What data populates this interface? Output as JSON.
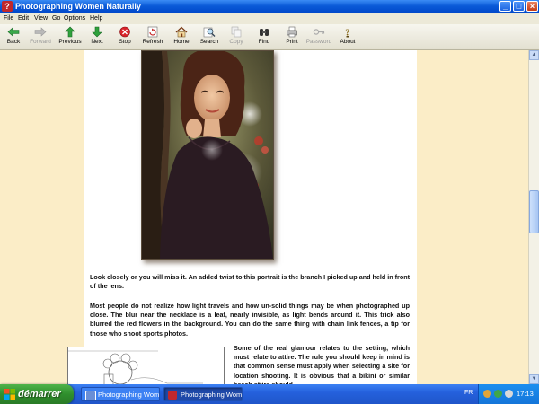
{
  "window": {
    "title": "Photographing Women Naturally",
    "app_icon": "help-book-icon"
  },
  "menu": [
    "File",
    "Edit",
    "View",
    "Go",
    "Options",
    "Help"
  ],
  "toolbar": [
    {
      "label": "Back",
      "icon": "back-arrow-icon",
      "enabled": true
    },
    {
      "label": "Forward",
      "icon": "forward-arrow-icon",
      "enabled": false
    },
    {
      "label": "Previous",
      "icon": "previous-arrow-icon",
      "enabled": true
    },
    {
      "label": "Next",
      "icon": "next-arrow-icon",
      "enabled": true
    },
    {
      "label": "Stop",
      "icon": "stop-icon",
      "enabled": true
    },
    {
      "label": "Refresh",
      "icon": "refresh-icon",
      "enabled": true
    },
    {
      "label": "Home",
      "icon": "home-icon",
      "enabled": true
    },
    {
      "label": "Search",
      "icon": "search-icon",
      "enabled": true
    },
    {
      "label": "Copy",
      "icon": "copy-icon",
      "enabled": false
    },
    {
      "label": "Find",
      "icon": "binoculars-icon",
      "enabled": true
    },
    {
      "label": "Print",
      "icon": "printer-icon",
      "enabled": true
    },
    {
      "label": "Password",
      "icon": "key-icon",
      "enabled": false
    },
    {
      "label": "About",
      "icon": "about-icon",
      "enabled": true
    }
  ],
  "content": {
    "caption": "Look closely or you will miss it. An added twist to this portrait is the branch I picked up and held in front of the lens.",
    "paragraph2": "Most people do not realize how light travels and how un-solid things may be when photographed up close. The blur near the necklace is a leaf, nearly invisible, as light bends around it. This trick also blurred the red flowers in the background. You can do the same thing with chain link fences, a tip for those who shoot sports photos.",
    "paragraph3": "Some of the real glamour relates to the setting, which must relate to attire. The rule you should keep in mind is that common sense must apply when selecting a site for location shooting. It is obvious that a bikini or similar beach attire should"
  },
  "taskbar": {
    "start_label": "démarrer",
    "tasks": [
      "Photographing Wome...",
      "Photographing Wome..."
    ],
    "language": "FR",
    "clock": "17:13"
  },
  "colors": {
    "page_background": "#fbedc7",
    "titlebar": "#0a5ad8",
    "taskbar": "#2561dd",
    "start_button": "#2f8f2d"
  }
}
